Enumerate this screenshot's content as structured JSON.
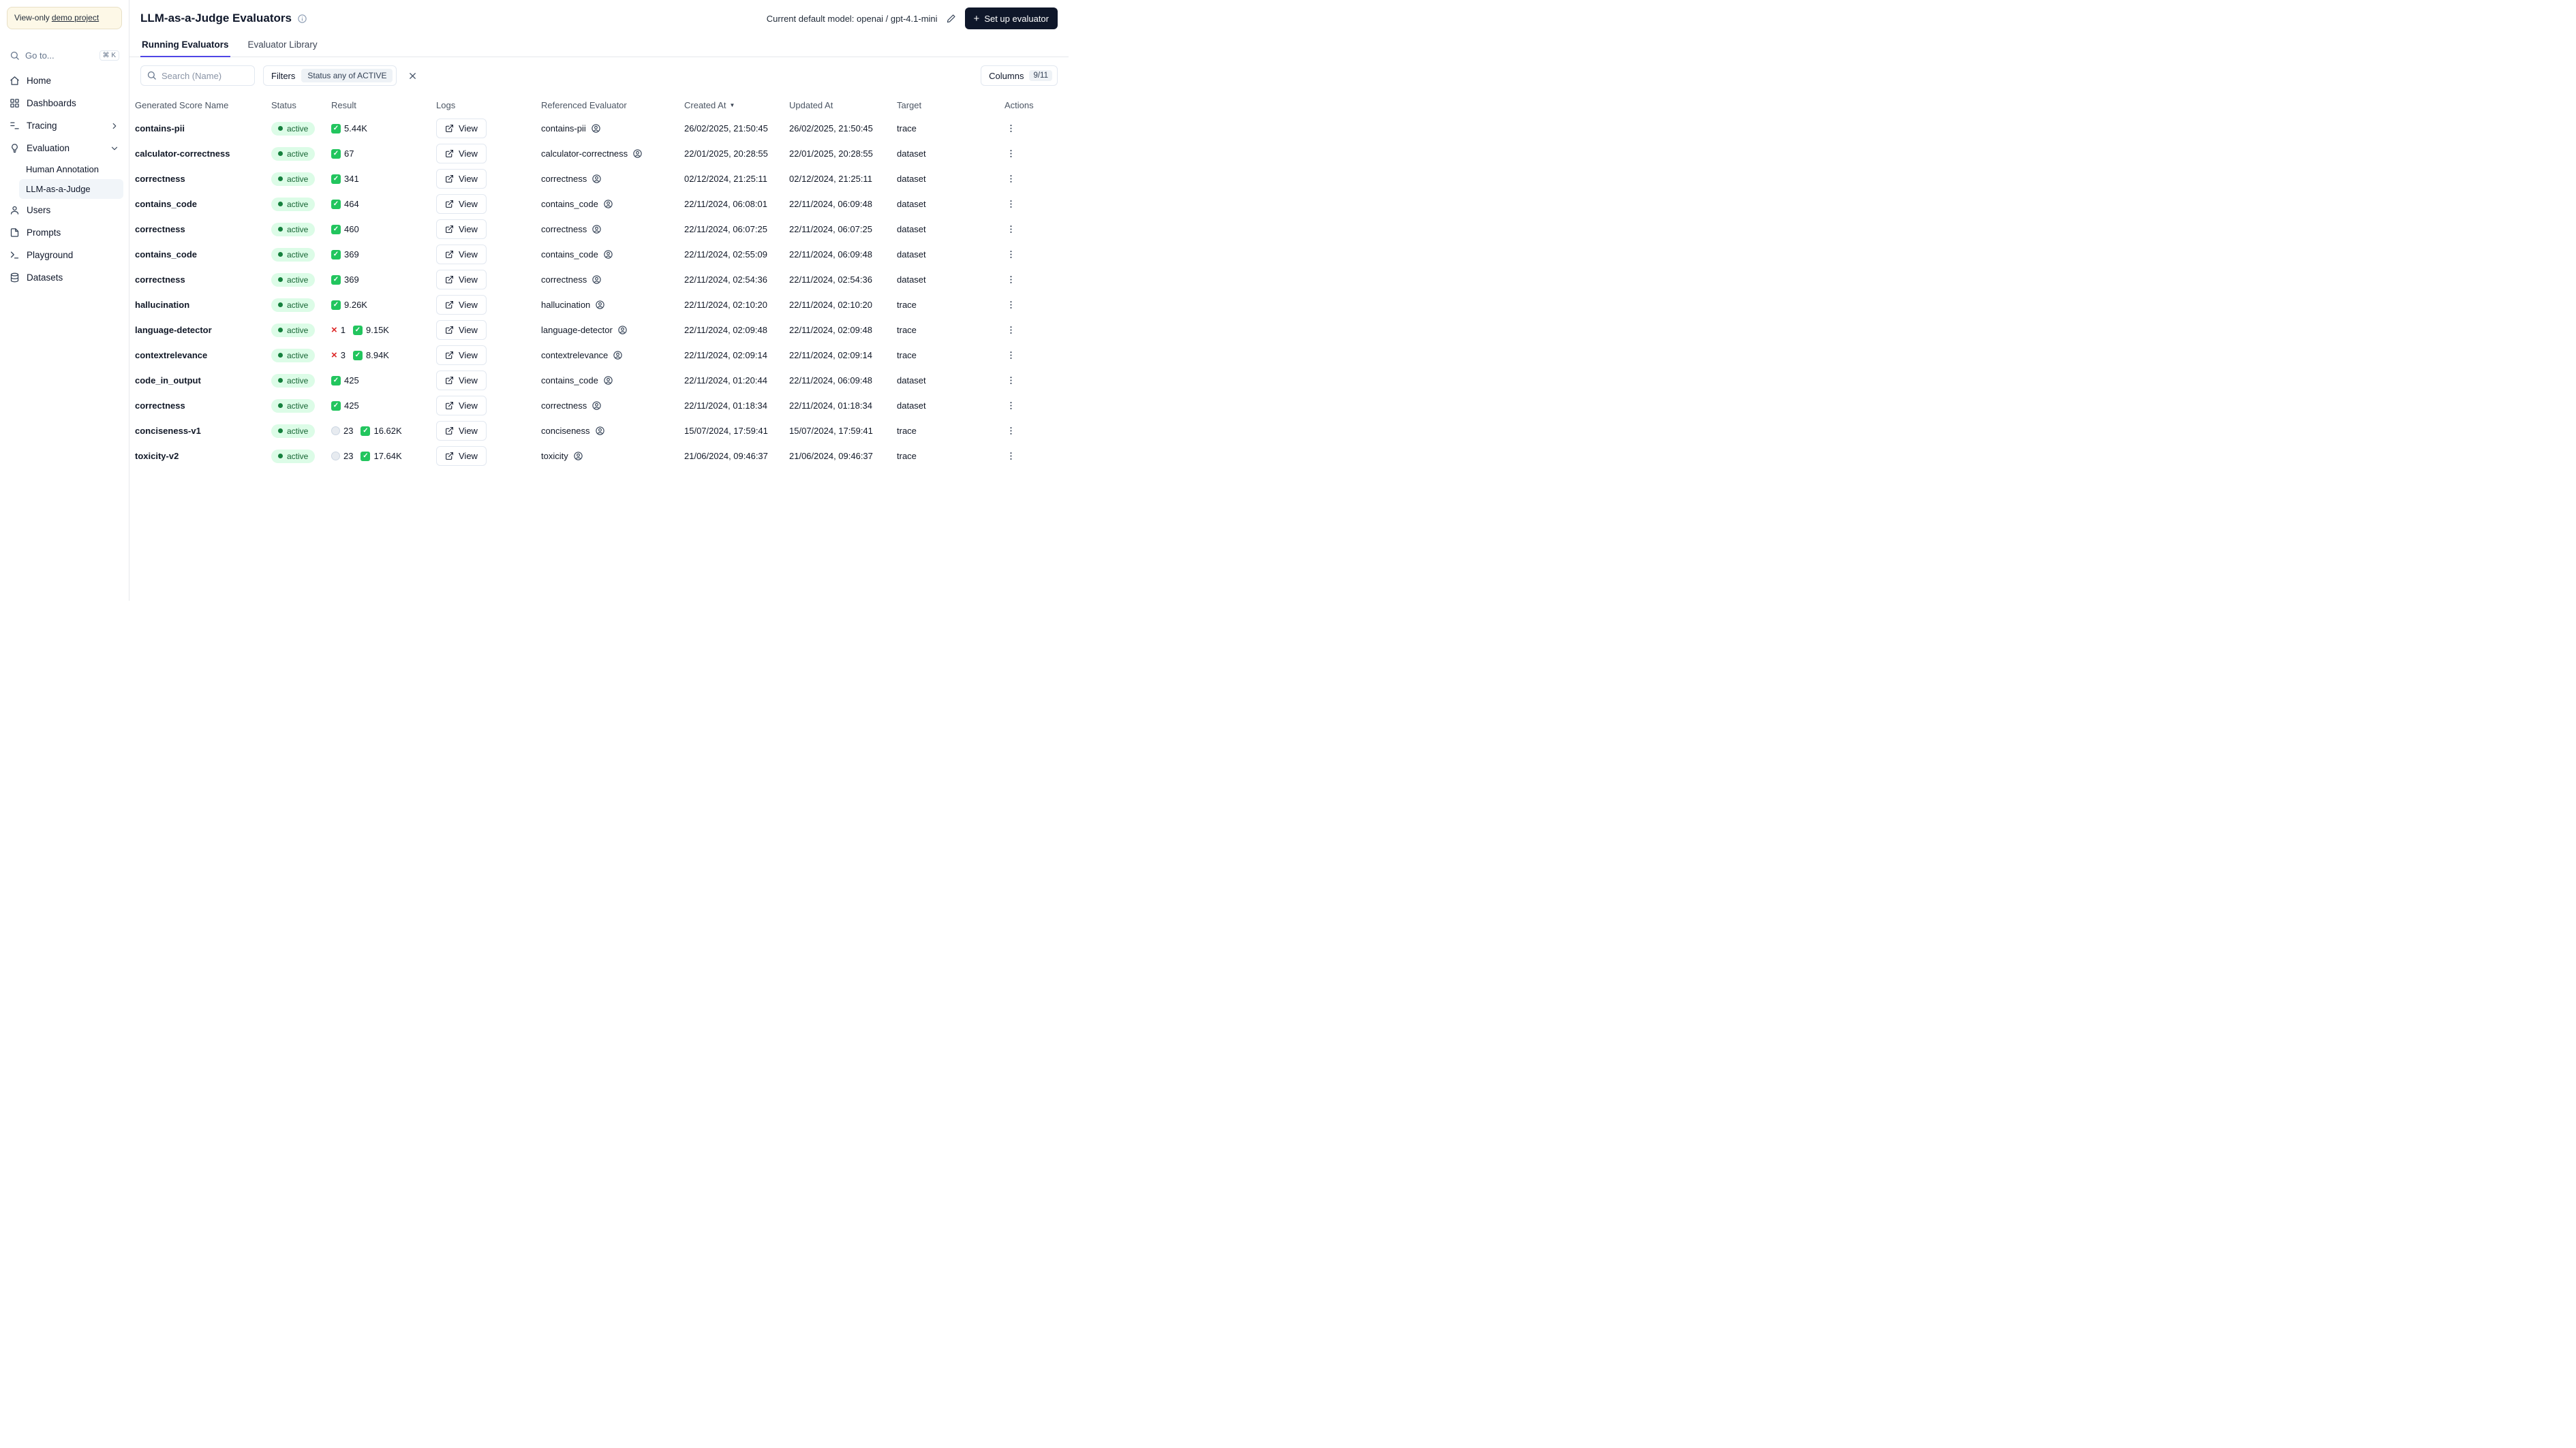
{
  "colors": {
    "accent": "#4f46e5",
    "primary": "#0f172a",
    "status-bg": "#dcfce7",
    "status-text": "#166534",
    "status-dot": "#15803d",
    "success": "#22c55e",
    "error": "#dc2626",
    "banner-bg": "#fdf8e7",
    "banner-border": "#e8e0c6"
  },
  "sidebar": {
    "banner": {
      "prefix": "View-only",
      "link_label": "demo project"
    },
    "goto": {
      "label": "Go to...",
      "shortcut": "⌘ K"
    },
    "items": [
      {
        "label": "Home"
      },
      {
        "label": "Dashboards"
      },
      {
        "label": "Tracing"
      },
      {
        "label": "Evaluation",
        "children": [
          {
            "label": "Human Annotation"
          },
          {
            "label": "LLM-as-a-Judge",
            "selected": true
          }
        ]
      },
      {
        "label": "Users"
      },
      {
        "label": "Prompts"
      },
      {
        "label": "Playground"
      },
      {
        "label": "Datasets"
      }
    ]
  },
  "header": {
    "title": "LLM-as-a-Judge Evaluators",
    "default_model": "Current default model: openai / gpt-4.1-mini",
    "setup_button_label": "Set up evaluator"
  },
  "tabs": [
    {
      "label": "Running Evaluators"
    },
    {
      "label": "Evaluator Library"
    }
  ],
  "toolbar": {
    "search_placeholder": "Search (Name)",
    "filters_label": "Filters",
    "filter_chip": "Status any of ACTIVE",
    "columns_label": "Columns",
    "columns_count": "9/11"
  },
  "table": {
    "columns": [
      "Generated Score Name",
      "Status",
      "Result",
      "Logs",
      "Referenced Evaluator",
      "Created At",
      "Updated At",
      "Target",
      "Actions"
    ],
    "sort_column": "Created At",
    "sort_direction": "desc",
    "sort_indicator": "▼",
    "view_label": "View",
    "rows": [
      {
        "name": "contains-pii",
        "status": "active",
        "result": [
          {
            "type": "success",
            "value": "5.44K"
          }
        ],
        "evaluator": "contains-pii",
        "created": "26/02/2025, 21:50:45",
        "updated": "26/02/2025, 21:50:45",
        "target": "trace"
      },
      {
        "name": "calculator-correctness",
        "status": "active",
        "result": [
          {
            "type": "success",
            "value": "67"
          }
        ],
        "evaluator": "calculator-correctness",
        "created": "22/01/2025, 20:28:55",
        "updated": "22/01/2025, 20:28:55",
        "target": "dataset"
      },
      {
        "name": "correctness",
        "status": "active",
        "result": [
          {
            "type": "success",
            "value": "341"
          }
        ],
        "evaluator": "correctness",
        "created": "02/12/2024, 21:25:11",
        "updated": "02/12/2024, 21:25:11",
        "target": "dataset"
      },
      {
        "name": "contains_code",
        "status": "active",
        "result": [
          {
            "type": "success",
            "value": "464"
          }
        ],
        "evaluator": "contains_code",
        "created": "22/11/2024, 06:08:01",
        "updated": "22/11/2024, 06:09:48",
        "target": "dataset"
      },
      {
        "name": "correctness",
        "status": "active",
        "result": [
          {
            "type": "success",
            "value": "460"
          }
        ],
        "evaluator": "correctness",
        "created": "22/11/2024, 06:07:25",
        "updated": "22/11/2024, 06:07:25",
        "target": "dataset"
      },
      {
        "name": "contains_code",
        "status": "active",
        "result": [
          {
            "type": "success",
            "value": "369"
          }
        ],
        "evaluator": "contains_code",
        "created": "22/11/2024, 02:55:09",
        "updated": "22/11/2024, 06:09:48",
        "target": "dataset"
      },
      {
        "name": "correctness",
        "status": "active",
        "result": [
          {
            "type": "success",
            "value": "369"
          }
        ],
        "evaluator": "correctness",
        "created": "22/11/2024, 02:54:36",
        "updated": "22/11/2024, 02:54:36",
        "target": "dataset"
      },
      {
        "name": "hallucination",
        "status": "active",
        "result": [
          {
            "type": "success",
            "value": "9.26K"
          }
        ],
        "evaluator": "hallucination",
        "created": "22/11/2024, 02:10:20",
        "updated": "22/11/2024, 02:10:20",
        "target": "trace"
      },
      {
        "name": "language-detector",
        "status": "active",
        "result": [
          {
            "type": "error",
            "value": "1"
          },
          {
            "type": "success",
            "value": "9.15K"
          }
        ],
        "evaluator": "language-detector",
        "created": "22/11/2024, 02:09:48",
        "updated": "22/11/2024, 02:09:48",
        "target": "trace"
      },
      {
        "name": "contextrelevance",
        "status": "active",
        "result": [
          {
            "type": "error",
            "value": "3"
          },
          {
            "type": "success",
            "value": "8.94K"
          }
        ],
        "evaluator": "contextrelevance",
        "created": "22/11/2024, 02:09:14",
        "updated": "22/11/2024, 02:09:14",
        "target": "trace"
      },
      {
        "name": "code_in_output",
        "status": "active",
        "result": [
          {
            "type": "success",
            "value": "425"
          }
        ],
        "evaluator": "contains_code",
        "created": "22/11/2024, 01:20:44",
        "updated": "22/11/2024, 06:09:48",
        "target": "dataset"
      },
      {
        "name": "correctness",
        "status": "active",
        "result": [
          {
            "type": "success",
            "value": "425"
          }
        ],
        "evaluator": "correctness",
        "created": "22/11/2024, 01:18:34",
        "updated": "22/11/2024, 01:18:34",
        "target": "dataset"
      },
      {
        "name": "conciseness-v1",
        "status": "active",
        "result": [
          {
            "type": "pending",
            "value": "23"
          },
          {
            "type": "success",
            "value": "16.62K"
          }
        ],
        "evaluator": "conciseness",
        "created": "15/07/2024, 17:59:41",
        "updated": "15/07/2024, 17:59:41",
        "target": "trace"
      },
      {
        "name": "toxicity-v2",
        "status": "active",
        "result": [
          {
            "type": "pending",
            "value": "23"
          },
          {
            "type": "success",
            "value": "17.64K"
          }
        ],
        "evaluator": "toxicity",
        "created": "21/06/2024, 09:46:37",
        "updated": "21/06/2024, 09:46:37",
        "target": "trace"
      }
    ]
  }
}
